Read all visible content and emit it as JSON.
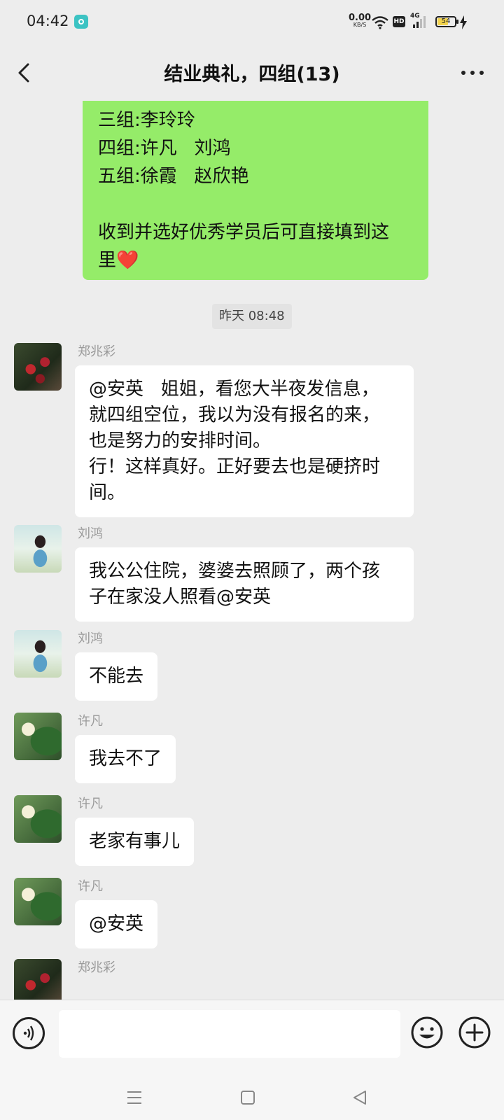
{
  "status_bar": {
    "time": "04:42",
    "net_speed": "0.00",
    "net_unit": "KB/S",
    "hd": "HD",
    "signal": "4G",
    "battery": "54"
  },
  "header": {
    "title": "结业典礼，四组(13)",
    "back_icon": "chevron-left-icon",
    "more_icon": "more-horizontal-icon"
  },
  "own_message": {
    "lines": [
      "三组:李玲玲",
      "四组:许凡   刘鸿",
      "五组:徐霞   赵欣艳",
      "",
      "收到并选好优秀学员后可直接填到这",
      "里"
    ],
    "emoji": "❤️",
    "bubble_color": "#95ec69"
  },
  "timestamp": "昨天 08:48",
  "messages": [
    {
      "sender": "郑兆彩",
      "lines": [
        "@安英   姐姐，看您大半夜发信息，",
        "就四组空位，我以为没有报名的来，",
        "也是努力的安排时间。",
        "行！这样真好。正好要去也是硬挤时",
        "间。"
      ]
    },
    {
      "sender": "刘鸿",
      "lines": [
        "我公公住院，婆婆去照顾了，两个孩",
        "子在家没人照看@安英"
      ]
    },
    {
      "sender": "刘鸿",
      "lines": [
        "不能去"
      ]
    },
    {
      "sender": "许凡",
      "lines": [
        "我去不了"
      ]
    },
    {
      "sender": "许凡",
      "lines": [
        "老家有事儿"
      ]
    },
    {
      "sender": "许凡",
      "lines": [
        "@安英"
      ]
    },
    {
      "sender": "郑兆彩",
      "lines": []
    }
  ],
  "input_bar": {
    "voice_icon": "voice-icon",
    "emoji_icon": "emoji-icon",
    "plus_icon": "plus-icon"
  },
  "colors": {
    "background": "#ededed",
    "own_bubble": "#95ec69",
    "other_bubble": "#ffffff",
    "sender_name": "#9a9a9a"
  }
}
